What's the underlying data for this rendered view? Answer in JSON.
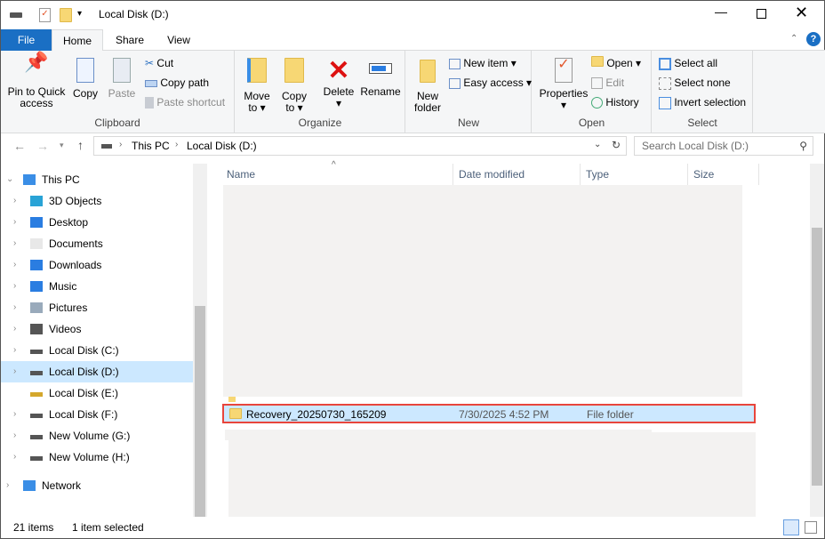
{
  "window": {
    "title": "Local Disk (D:)"
  },
  "ribbon_tabs": {
    "file": "File",
    "home": "Home",
    "share": "Share",
    "view": "View"
  },
  "clipboard": {
    "pin": "Pin to Quick access",
    "copy": "Copy",
    "paste": "Paste",
    "cut": "Cut",
    "copy_path": "Copy path",
    "paste_shortcut": "Paste shortcut",
    "label": "Clipboard"
  },
  "organize": {
    "move_to": "Move to",
    "copy_to": "Copy to",
    "delete": "Delete",
    "rename": "Rename",
    "label": "Organize"
  },
  "new": {
    "new_folder": "New folder",
    "new_item": "New item",
    "easy_access": "Easy access",
    "label": "New"
  },
  "open": {
    "properties": "Properties",
    "open": "Open",
    "edit": "Edit",
    "history": "History",
    "label": "Open"
  },
  "select": {
    "select_all": "Select all",
    "select_none": "Select none",
    "invert": "Invert selection",
    "label": "Select"
  },
  "address": {
    "crumbs": [
      "This PC",
      "Local Disk (D:)"
    ]
  },
  "search": {
    "placeholder": "Search Local Disk (D:)"
  },
  "nav": [
    {
      "label": "This PC",
      "icon": "pc",
      "expanded": true
    },
    {
      "label": "3D Objects",
      "icon": "3d"
    },
    {
      "label": "Desktop",
      "icon": "desktop"
    },
    {
      "label": "Documents",
      "icon": "documents"
    },
    {
      "label": "Downloads",
      "icon": "downloads"
    },
    {
      "label": "Music",
      "icon": "music"
    },
    {
      "label": "Pictures",
      "icon": "pictures"
    },
    {
      "label": "Videos",
      "icon": "videos"
    },
    {
      "label": "Local Disk (C:)",
      "icon": "drive"
    },
    {
      "label": "Local Disk (D:)",
      "icon": "drive",
      "selected": true
    },
    {
      "label": "Local Disk (E:)",
      "icon": "drive-locked"
    },
    {
      "label": "Local Disk (F:)",
      "icon": "drive"
    },
    {
      "label": "New Volume (G:)",
      "icon": "drive"
    },
    {
      "label": "New Volume (H:)",
      "icon": "drive"
    },
    {
      "label": "Network",
      "icon": "network"
    }
  ],
  "columns": {
    "name": "Name",
    "date": "Date modified",
    "type": "Type",
    "size": "Size"
  },
  "selected_row": {
    "name": "Recovery_20250730_165209",
    "date": "7/30/2025 4:52 PM",
    "type": "File folder"
  },
  "status": {
    "items": "21 items",
    "selected": "1 item selected"
  },
  "colors": {
    "accent": "#1a6fc4",
    "selection": "#cce8ff",
    "highlight_border": "#e8453c"
  }
}
